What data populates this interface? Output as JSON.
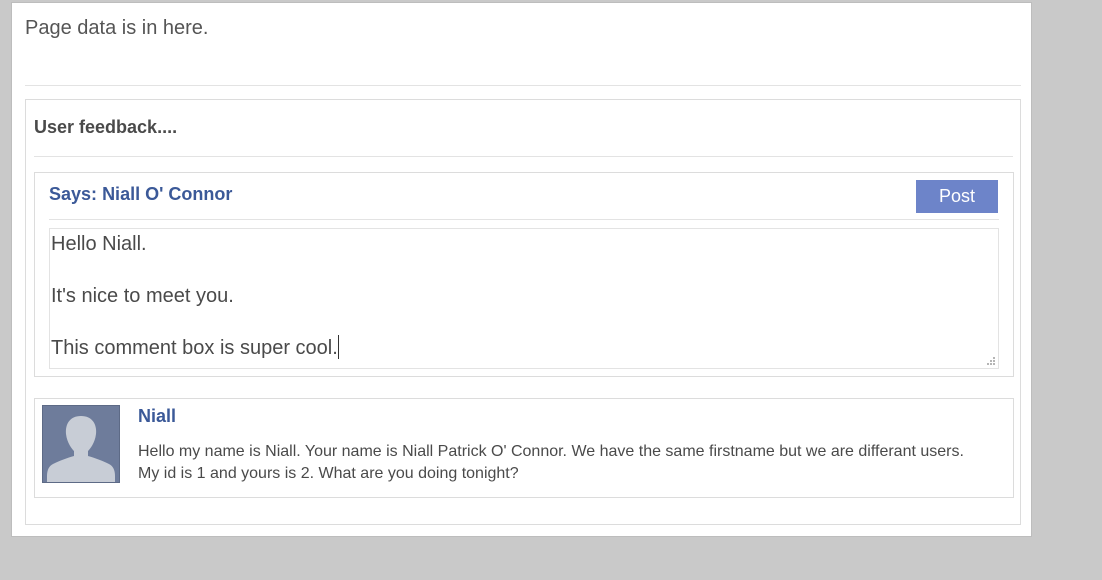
{
  "page": {
    "text": "Page data is in here."
  },
  "feedback": {
    "title": "User feedback....",
    "composer": {
      "says_prefix": "Says:",
      "says_name": "Niall O' Connor",
      "post_label": "Post",
      "text_lines": [
        "Hello Niall.",
        "",
        "It's nice to meet you.",
        "",
        "This comment box is super cool."
      ]
    },
    "comments": [
      {
        "author": "Niall",
        "body": "Hello my name is Niall. Your name is Niall Patrick O' Connor. We have the same firstname but we are differant users. My id is 1 and yours is 2. What are you doing tonight?"
      }
    ]
  },
  "icons": {
    "avatar": "default-user-avatar-icon",
    "resize": "resize-grip-icon"
  },
  "colors": {
    "background": "#c9c9c9",
    "link_blue": "#3b5998",
    "button_blue": "#6d84c9",
    "avatar_bg": "#6e7c9b"
  }
}
